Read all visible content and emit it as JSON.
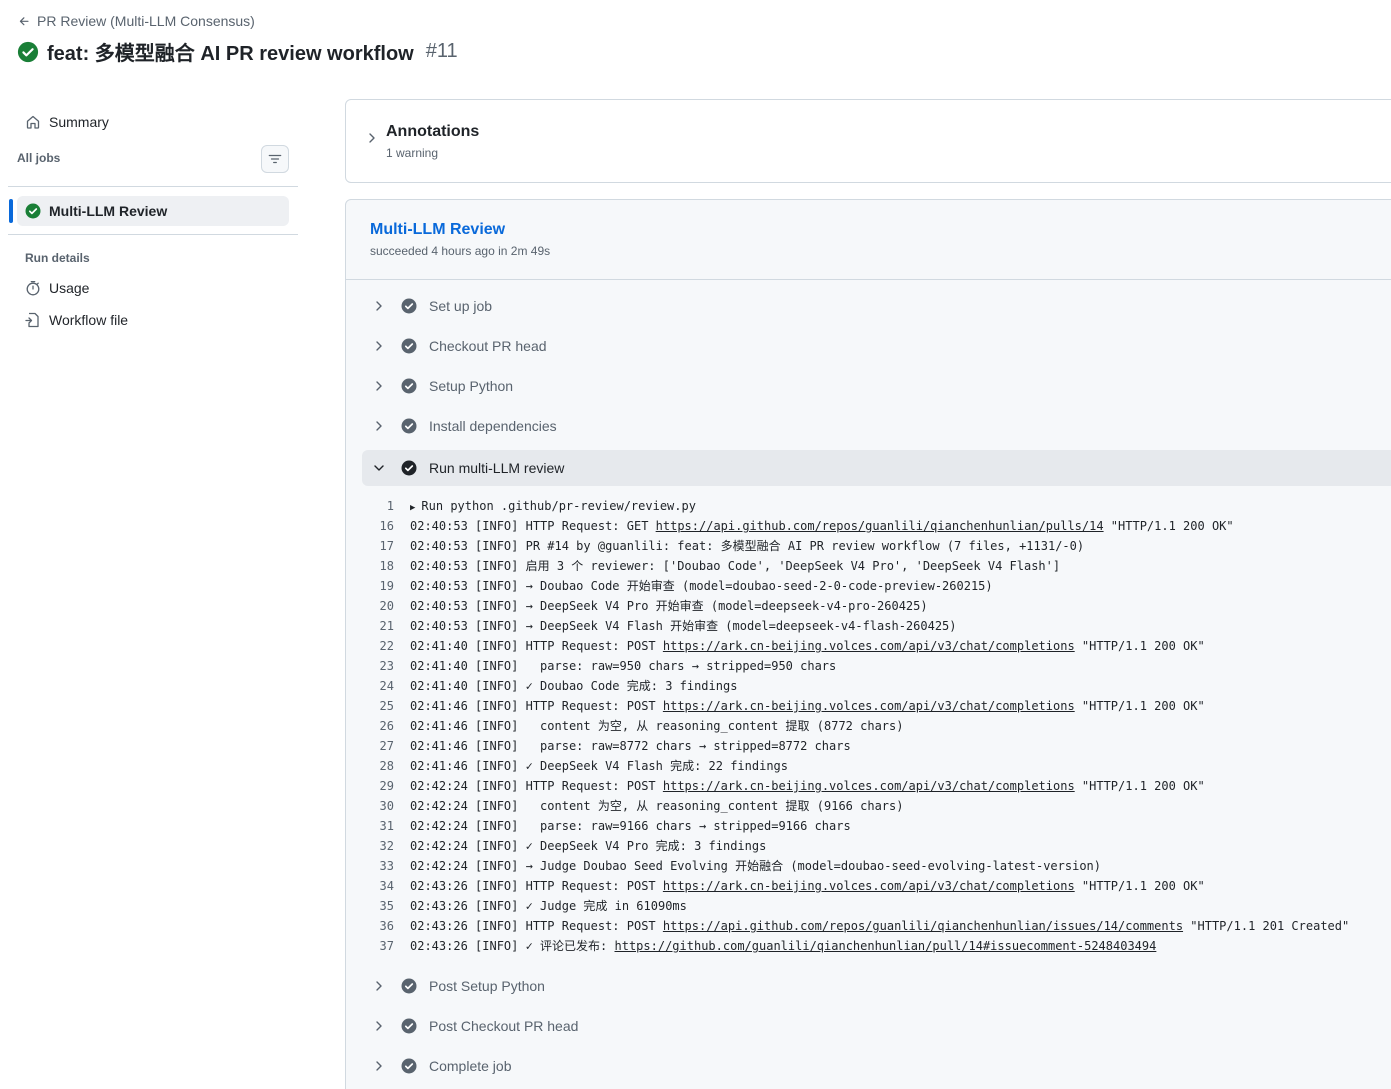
{
  "header": {
    "back_label": "PR Review (Multi-LLM Consensus)",
    "run_title": "feat: 多模型融合 AI PR review workflow",
    "run_number": "#11"
  },
  "sidebar": {
    "summary_label": "Summary",
    "all_jobs_label": "All jobs",
    "job_label": "Multi-LLM Review",
    "run_details_label": "Run details",
    "usage_label": "Usage",
    "workflow_label": "Workflow file"
  },
  "annotations": {
    "title": "Annotations",
    "subtitle": "1 warning"
  },
  "job": {
    "name": "Multi-LLM Review",
    "status": "succeeded 4 hours ago in 2m 49s"
  },
  "steps_before": [
    "Set up job",
    "Checkout PR head",
    "Setup Python",
    "Install dependencies"
  ],
  "expanded_step": "Run multi-LLM review",
  "steps_after": [
    "Post Setup Python",
    "Post Checkout PR head",
    "Complete job"
  ],
  "log": [
    {
      "n": "1",
      "pre": "Run python .github/pr-review/review.py",
      "link": "",
      "post": "",
      "collapsed": true
    },
    {
      "n": "16",
      "pre": "02:40:53 [INFO] HTTP Request: GET ",
      "link": "https://api.github.com/repos/guanlili/qianchenhunlian/pulls/14",
      "post": " \"HTTP/1.1 200 OK\""
    },
    {
      "n": "17",
      "pre": "02:40:53 [INFO] PR #14 by @guanlili: feat: 多模型融合 AI PR review workflow (7 files, +1131/-0)",
      "link": "",
      "post": ""
    },
    {
      "n": "18",
      "pre": "02:40:53 [INFO] 启用 3 个 reviewer: ['Doubao Code', 'DeepSeek V4 Pro', 'DeepSeek V4 Flash']",
      "link": "",
      "post": ""
    },
    {
      "n": "19",
      "pre": "02:40:53 [INFO] → Doubao Code 开始审查 (model=doubao-seed-2-0-code-preview-260215)",
      "link": "",
      "post": ""
    },
    {
      "n": "20",
      "pre": "02:40:53 [INFO] → DeepSeek V4 Pro 开始审查 (model=deepseek-v4-pro-260425)",
      "link": "",
      "post": ""
    },
    {
      "n": "21",
      "pre": "02:40:53 [INFO] → DeepSeek V4 Flash 开始审查 (model=deepseek-v4-flash-260425)",
      "link": "",
      "post": ""
    },
    {
      "n": "22",
      "pre": "02:41:40 [INFO] HTTP Request: POST ",
      "link": "https://ark.cn-beijing.volces.com/api/v3/chat/completions",
      "post": " \"HTTP/1.1 200 OK\""
    },
    {
      "n": "23",
      "pre": "02:41:40 [INFO]   parse: raw=950 chars → stripped=950 chars",
      "link": "",
      "post": ""
    },
    {
      "n": "24",
      "pre": "02:41:40 [INFO] ✓ Doubao Code 完成: 3 findings",
      "link": "",
      "post": ""
    },
    {
      "n": "25",
      "pre": "02:41:46 [INFO] HTTP Request: POST ",
      "link": "https://ark.cn-beijing.volces.com/api/v3/chat/completions",
      "post": " \"HTTP/1.1 200 OK\""
    },
    {
      "n": "26",
      "pre": "02:41:46 [INFO]   content 为空, 从 reasoning_content 提取 (8772 chars)",
      "link": "",
      "post": ""
    },
    {
      "n": "27",
      "pre": "02:41:46 [INFO]   parse: raw=8772 chars → stripped=8772 chars",
      "link": "",
      "post": ""
    },
    {
      "n": "28",
      "pre": "02:41:46 [INFO] ✓ DeepSeek V4 Flash 完成: 22 findings",
      "link": "",
      "post": ""
    },
    {
      "n": "29",
      "pre": "02:42:24 [INFO] HTTP Request: POST ",
      "link": "https://ark.cn-beijing.volces.com/api/v3/chat/completions",
      "post": " \"HTTP/1.1 200 OK\""
    },
    {
      "n": "30",
      "pre": "02:42:24 [INFO]   content 为空, 从 reasoning_content 提取 (9166 chars)",
      "link": "",
      "post": ""
    },
    {
      "n": "31",
      "pre": "02:42:24 [INFO]   parse: raw=9166 chars → stripped=9166 chars",
      "link": "",
      "post": ""
    },
    {
      "n": "32",
      "pre": "02:42:24 [INFO] ✓ DeepSeek V4 Pro 完成: 3 findings",
      "link": "",
      "post": ""
    },
    {
      "n": "33",
      "pre": "02:42:24 [INFO] → Judge Doubao Seed Evolving 开始融合 (model=doubao-seed-evolving-latest-version)",
      "link": "",
      "post": ""
    },
    {
      "n": "34",
      "pre": "02:43:26 [INFO] HTTP Request: POST ",
      "link": "https://ark.cn-beijing.volces.com/api/v3/chat/completions",
      "post": " \"HTTP/1.1 200 OK\""
    },
    {
      "n": "35",
      "pre": "02:43:26 [INFO] ✓ Judge 完成 in 61090ms",
      "link": "",
      "post": ""
    },
    {
      "n": "36",
      "pre": "02:43:26 [INFO] HTTP Request: POST ",
      "link": "https://api.github.com/repos/guanlili/qianchenhunlian/issues/14/comments",
      "post": " \"HTTP/1.1 201 Created\""
    },
    {
      "n": "37",
      "pre": "02:43:26 [INFO] ✓ 评论已发布: ",
      "link": "https://github.com/guanlili/qianchenhunlian/pull/14#issuecomment-5248403494",
      "post": ""
    }
  ],
  "colors": {
    "success": "#1a7f37",
    "step_check": "#59636e",
    "link_blue": "#0969da",
    "active_bar": "#0969da"
  },
  "icons": [
    "arrow-left-icon",
    "check-circle-icon",
    "home-icon",
    "filter-icon",
    "stopwatch-icon",
    "workflow-file-icon",
    "chevron-right-icon",
    "chevron-down-icon",
    "triangle-right-icon"
  ]
}
